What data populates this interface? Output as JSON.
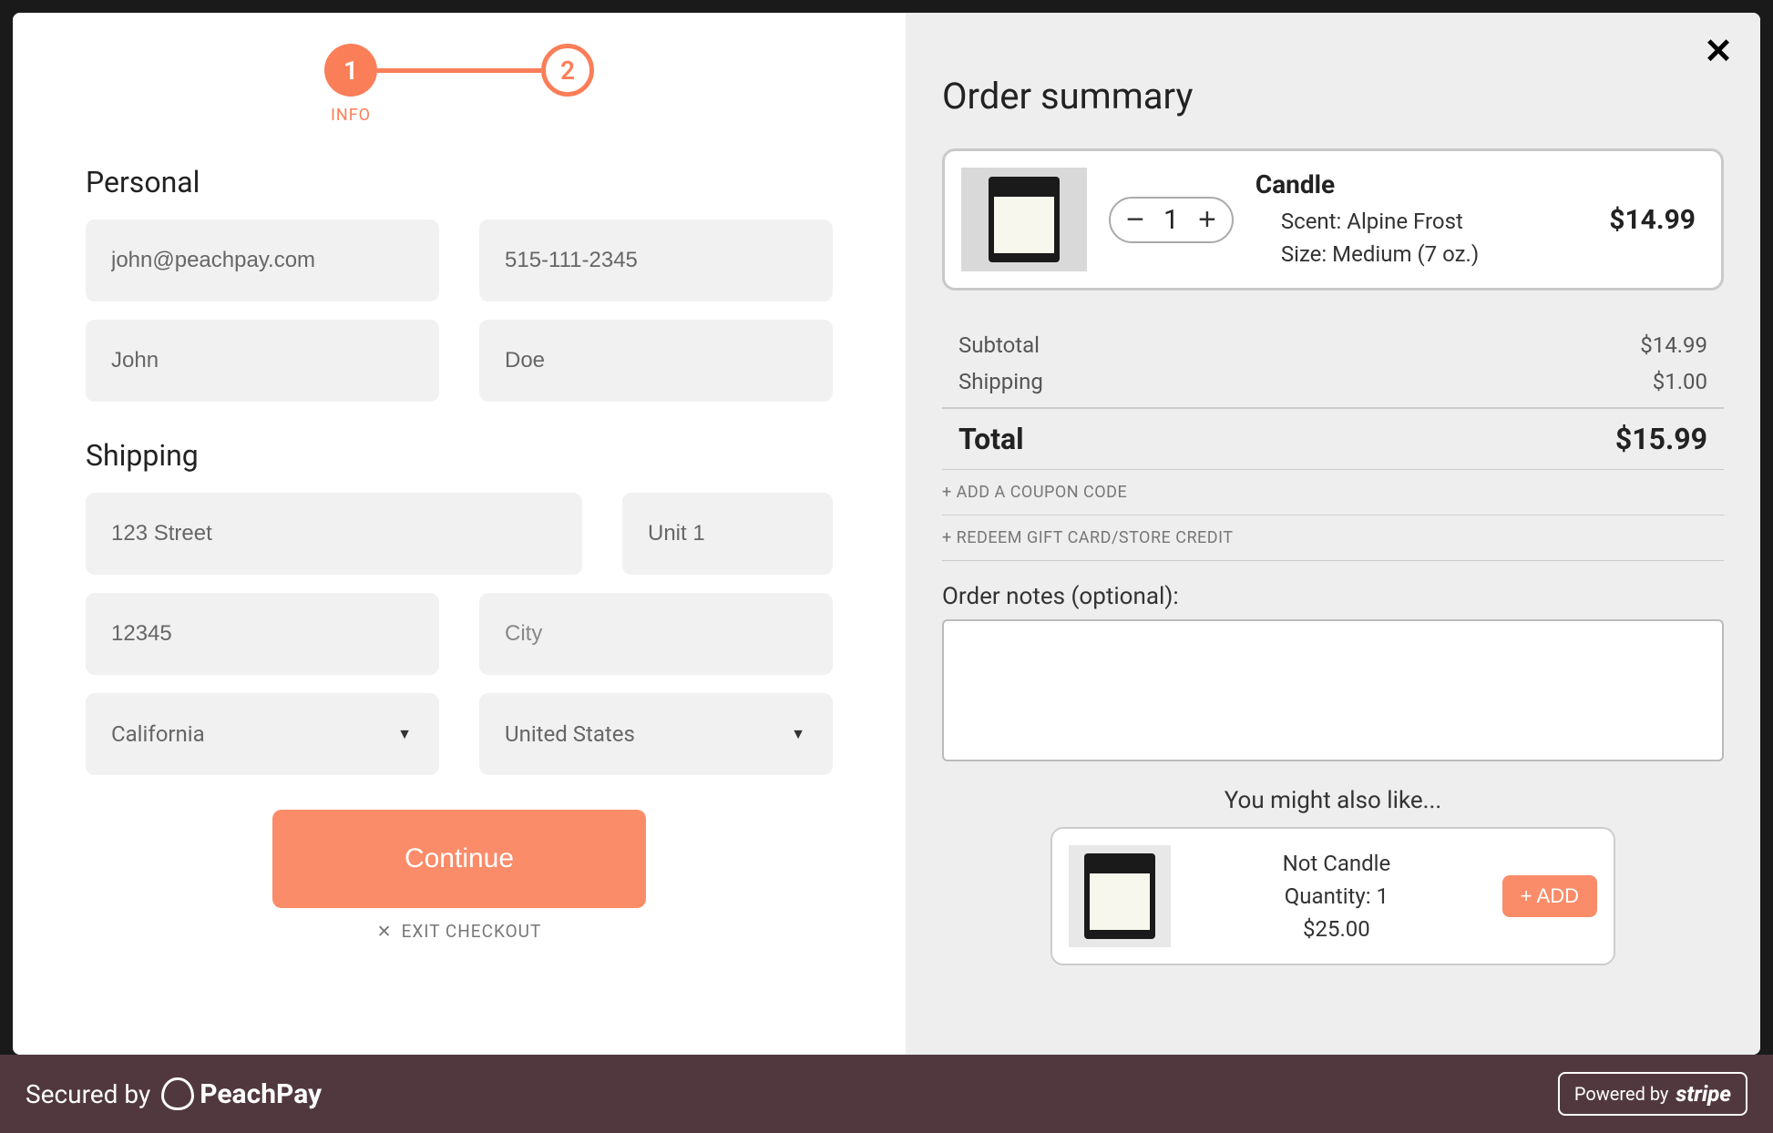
{
  "stepper": {
    "step1": "1",
    "step1_label": "INFO",
    "step2": "2"
  },
  "form": {
    "personal_heading": "Personal",
    "email": "john@peachpay.com",
    "phone": "515-111-2345",
    "first_name": "John",
    "last_name": "Doe",
    "shipping_heading": "Shipping",
    "address1": "123 Street",
    "address2": "Unit 1",
    "postal": "12345",
    "city_placeholder": "City",
    "state": "California",
    "country": "United States",
    "continue_label": "Continue",
    "exit_label": "EXIT CHECKOUT"
  },
  "summary": {
    "heading": "Order summary",
    "item": {
      "name": "Candle",
      "quantity": "1",
      "scent_label": "Scent: Alpine Frost",
      "size_label": "Size: Medium (7 oz.)",
      "price": "$14.99"
    },
    "subtotal_label": "Subtotal",
    "subtotal_value": "$14.99",
    "shipping_label": "Shipping",
    "shipping_value": "$1.00",
    "total_label": "Total",
    "total_value": "$15.99",
    "coupon_label": "+ ADD A COUPON CODE",
    "gift_label": "+ REDEEM GIFT CARD/STORE CREDIT",
    "notes_label": "Order notes (optional):",
    "suggest_heading": "You might also like...",
    "suggest": {
      "name": "Not Candle",
      "qty_label": "Quantity: 1",
      "price": "$25.00",
      "add_label": "+ ADD"
    }
  },
  "footer": {
    "secured_prefix": "Secured by",
    "brand": "PeachPay",
    "powered_prefix": "Powered by",
    "stripe": "stripe"
  }
}
